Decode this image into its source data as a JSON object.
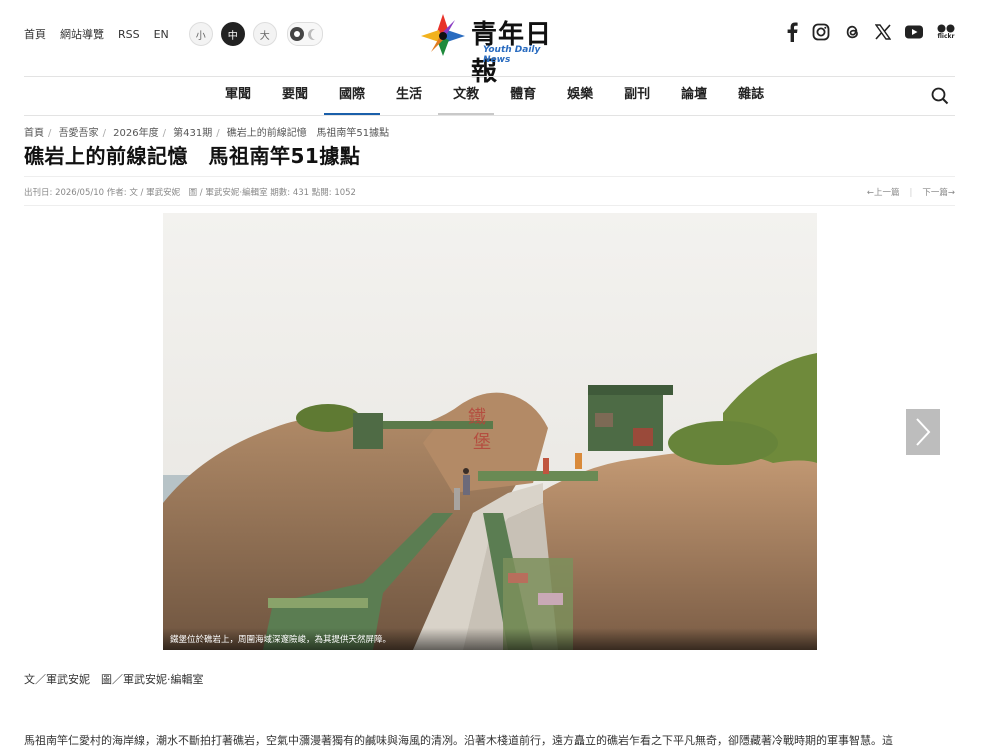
{
  "utility": {
    "links": [
      "首頁",
      "網站導覽",
      "RSS",
      "EN"
    ],
    "font_sizes": [
      "小",
      "中",
      "大"
    ],
    "active_font_size": "中"
  },
  "logo": {
    "cn": "青年日報",
    "en": "Youth Daily News"
  },
  "social": [
    "facebook-icon",
    "instagram-icon",
    "threads-icon",
    "x-icon",
    "youtube-icon",
    "flickr-icon"
  ],
  "social_flickr_label": "flickr",
  "nav": {
    "items": [
      "軍聞",
      "要聞",
      "國際",
      "生活",
      "文教",
      "體育",
      "娛樂",
      "副刊",
      "論壇",
      "雜誌"
    ],
    "active": "國際"
  },
  "breadcrumb": [
    "首頁",
    "吾愛吾家",
    "2026年度",
    "第431期",
    "礁岩上的前線記憶",
    "馬祖南竿51據點"
  ],
  "article": {
    "title": "礁岩上的前線記憶　馬祖南竿51據點",
    "meta": "出刊日: 2026/05/10  作者: 文 / 軍武安妮　圖 / 軍武安妮·編輯室  期數: 431  點閱: 1052",
    "prev": "←上一篇",
    "next": "下一篇→",
    "caption": "鐵堡位於礁岩上，周圍海域深邃險峻，為其提供天然屏障。",
    "byline": "文／軍武安妮　圖／軍武安妮‧編輯室",
    "body": "馬祖南竿仁愛村的海岸線，潮水不斷拍打著礁岩，空氣中瀰漫著獨有的鹹味與海風的清冽。沿著木棧道前行，遠方矗立的礁岩乍看之下平凡無奇，卻隱藏著冷戰時期的軍事智慧。這"
  },
  "colors": {
    "accent": "#1a5faa",
    "text": "#333333",
    "title": "#111111"
  }
}
